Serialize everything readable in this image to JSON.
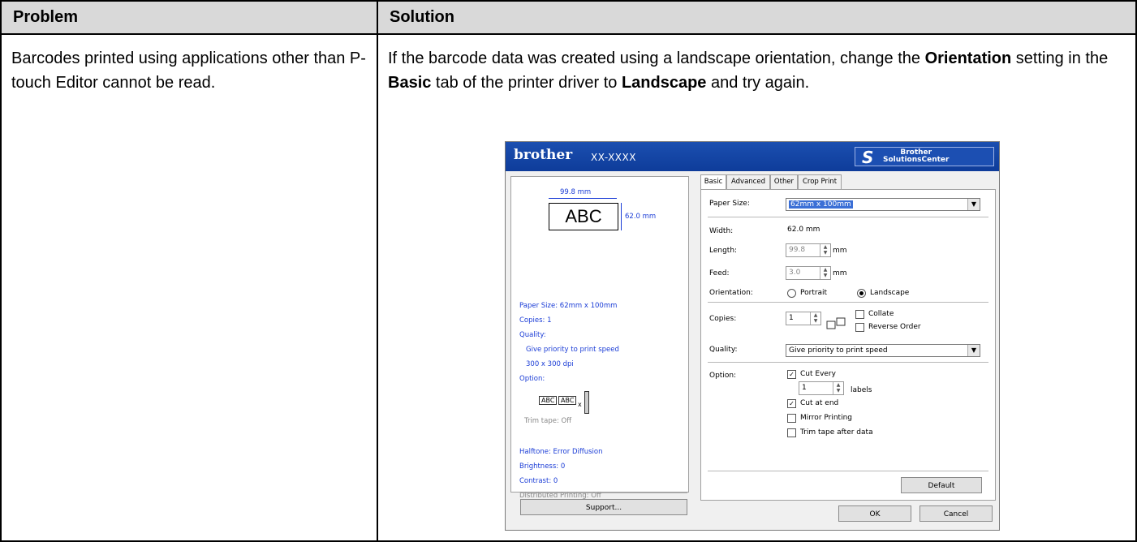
{
  "table": {
    "header_problem": "Problem",
    "header_solution": "Solution",
    "problem_text": "Barcodes printed using applications other than P-touch Editor cannot be read.",
    "solution_parts": {
      "a": "If the barcode data was created using a landscape orientation, change the ",
      "b": "Orientation",
      "c": " setting in the ",
      "d": "Basic",
      "e": " tab of the printer driver to ",
      "f": "Landscape",
      "g": " and try again."
    }
  },
  "dialog": {
    "brand": "brother",
    "model": "XX-XXXX",
    "solutions_center": "Brother\nSolutionsCenter",
    "preview": {
      "width_dim": "99.8 mm",
      "label_text": "ABC",
      "height_dim": "62.0 mm"
    },
    "summary": {
      "paper_size": "Paper Size: 62mm x 100mm",
      "copies": "Copies: 1",
      "quality": "Quality:",
      "quality_value": "Give priority to print speed",
      "resolution": "300 x 300 dpi",
      "option": "Option:",
      "option_icon_a": "ABC",
      "option_icon_b": "ABC",
      "option_icon_x": "x",
      "trim_tape": "Trim tape: Off",
      "halftone": "Halftone: Error Diffusion",
      "brightness": "Brightness:  0",
      "contrast": "Contrast:  0",
      "distributed": "Distributed Printing: Off"
    },
    "support_button": "Support...",
    "tabs": [
      "Basic",
      "Advanced",
      "Other",
      "Crop Print"
    ],
    "fields": {
      "paper_size_label": "Paper Size:",
      "paper_size_value": "62mm x 100mm",
      "width_label": "Width:",
      "width_value": "62.0 mm",
      "length_label": "Length:",
      "length_value": "99.8",
      "length_unit": "mm",
      "feed_label": "Feed:",
      "feed_value": "3.0",
      "feed_unit": "mm",
      "orientation_label": "Orientation:",
      "portrait": "Portrait",
      "landscape": "Landscape",
      "copies_label": "Copies:",
      "copies_value": "1",
      "collate": "Collate",
      "reverse_order": "Reverse Order",
      "quality_label": "Quality:",
      "quality_value": "Give priority to print speed",
      "option_label": "Option:",
      "cut_every": "Cut Every",
      "cut_every_value": "1",
      "labels": "labels",
      "cut_at_end": "Cut at end",
      "mirror_printing": "Mirror Printing",
      "trim_tape_after": "Trim tape after data"
    },
    "default_button": "Default",
    "ok_button": "OK",
    "cancel_button": "Cancel"
  }
}
